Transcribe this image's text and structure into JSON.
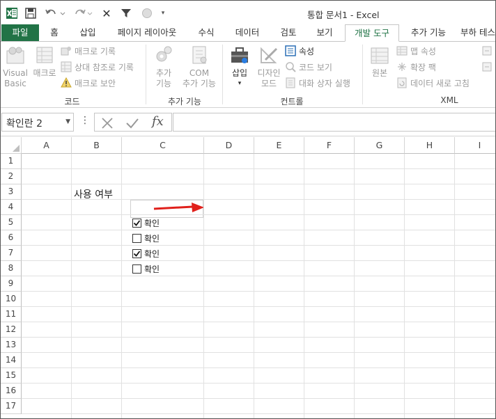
{
  "window": {
    "title": "통합 문서1 - Excel"
  },
  "tabs": [
    {
      "label": "파일"
    },
    {
      "label": "홈"
    },
    {
      "label": "삽입"
    },
    {
      "label": "페이지 레이아웃"
    },
    {
      "label": "수식"
    },
    {
      "label": "데이터"
    },
    {
      "label": "검토"
    },
    {
      "label": "보기"
    },
    {
      "label": "개발 도구"
    },
    {
      "label": "추가 기능"
    },
    {
      "label": "부하 테스트"
    }
  ],
  "ribbon": {
    "code": {
      "label": "코드",
      "visual_basic_1": "Visual",
      "visual_basic_2": "Basic",
      "macros": "매크로",
      "record_macro": "매크로 기록",
      "relative_refs": "상대 참조로 기록",
      "macro_security": "매크로 보안"
    },
    "addins": {
      "label": "추가 기능",
      "addins_1": "추가",
      "addins_2": "기능",
      "com_1": "COM",
      "com_2": "추가 기능"
    },
    "controls": {
      "label": "컨트롤",
      "insert": "삽입",
      "design_1": "디자인",
      "design_2": "모드",
      "properties": "속성",
      "view_code": "코드 보기",
      "run_dialog": "대화 상자 실행"
    },
    "xml": {
      "label": "XML",
      "source": "원본",
      "map_props": "맵 속성",
      "expansion_packs": "확장 팩",
      "refresh_data": "데이터 새로 고침"
    }
  },
  "formula_bar": {
    "name_box": "확인란 2",
    "fx": "fx",
    "value": ""
  },
  "sheet": {
    "columns": [
      "A",
      "B",
      "C",
      "D",
      "E",
      "F",
      "G",
      "H",
      "I"
    ],
    "rows": [
      "1",
      "2",
      "3",
      "4",
      "5",
      "6",
      "7",
      "8",
      "9",
      "10",
      "11",
      "12",
      "13",
      "14",
      "15",
      "16",
      "17"
    ],
    "b3_text": "사용 여부",
    "checkboxes": [
      {
        "label": "확인",
        "checked": true
      },
      {
        "label": "확인",
        "checked": false
      },
      {
        "label": "확인",
        "checked": true
      },
      {
        "label": "확인",
        "checked": false
      }
    ]
  },
  "colors": {
    "excel_green": "#217346",
    "arrow_red": "#e0201b"
  }
}
